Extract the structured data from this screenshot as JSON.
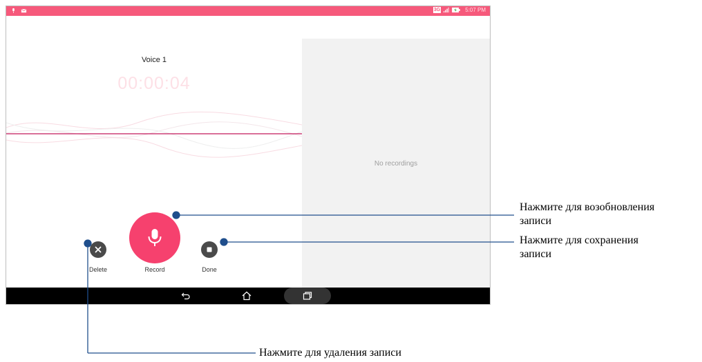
{
  "status_bar": {
    "network_badge": "3G",
    "time": "5:07 PM",
    "icons": [
      "mic-icon",
      "mail-icon",
      "signal-icon",
      "battery-charging-icon"
    ]
  },
  "recorder": {
    "title": "Voice 1",
    "timer": "00:00:04",
    "delete_label": "Delete",
    "record_label": "Record",
    "done_label": "Done"
  },
  "recordings": {
    "empty_text": "No recordings"
  },
  "navigation": {
    "icons": [
      "back-icon",
      "home-icon",
      "recent-apps-icon"
    ]
  },
  "callouts": {
    "resume_line1": "Нажмите для возобновления",
    "resume_line2": "записи",
    "save_line1": "Нажмите для сохранения",
    "save_line2": "записи",
    "delete": "Нажмите для удаления записи"
  },
  "colors": {
    "accent": "#f6416e",
    "status_bar": "#f6597b",
    "callout_line": "#1f4e8c"
  }
}
